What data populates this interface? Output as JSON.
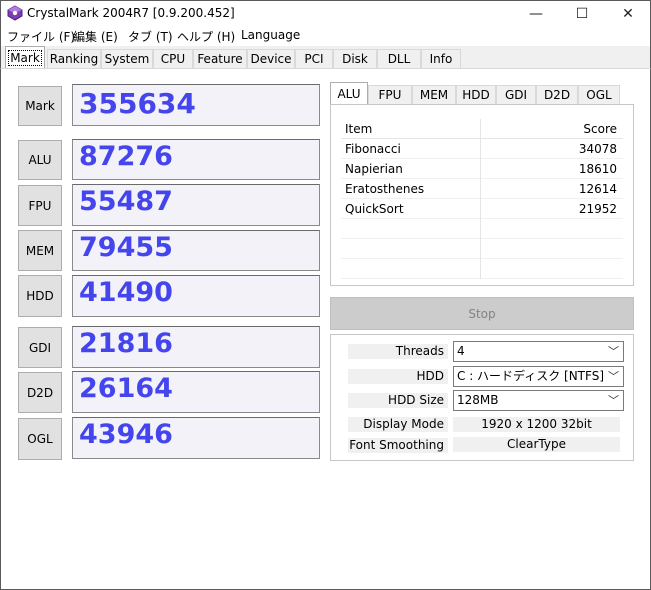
{
  "window": {
    "title": "CrystalMark 2004R7 [0.9.200.452]",
    "controls": {
      "minimize": "—",
      "maximize": "☐",
      "close": "✕"
    }
  },
  "menu": [
    "ファイル (F)",
    "編集 (E)",
    "タブ (T)",
    "ヘルプ (H)",
    "Language"
  ],
  "main_tabs": [
    "Mark",
    "Ranking",
    "System",
    "CPU",
    "Feature",
    "Device",
    "PCI",
    "Disk",
    "DLL",
    "Info"
  ],
  "active_main_tab": "Mark",
  "scores": [
    {
      "label": "Mark",
      "value": "355634"
    },
    {
      "label": "ALU",
      "value": "87276"
    },
    {
      "label": "FPU",
      "value": "55487"
    },
    {
      "label": "MEM",
      "value": "79455"
    },
    {
      "label": "HDD",
      "value": "41490"
    },
    {
      "label": "GDI",
      "value": "21816"
    },
    {
      "label": "D2D",
      "value": "26164"
    },
    {
      "label": "OGL",
      "value": "43946"
    }
  ],
  "sub_tabs": [
    "ALU",
    "FPU",
    "MEM",
    "HDD",
    "GDI",
    "D2D",
    "OGL"
  ],
  "active_sub_tab": "ALU",
  "result_table": {
    "headers": {
      "item": "Item",
      "score": "Score"
    },
    "rows": [
      {
        "item": "Fibonacci",
        "score": "34078"
      },
      {
        "item": "Napierian",
        "score": "18610"
      },
      {
        "item": "Eratosthenes",
        "score": "12614"
      },
      {
        "item": "QuickSort",
        "score": "21952"
      }
    ]
  },
  "stop_button": "Stop",
  "settings": {
    "threads": {
      "label": "Threads",
      "value": "4"
    },
    "hdd": {
      "label": "HDD",
      "value": "C : ハードディスク [NTFS]"
    },
    "hdd_size": {
      "label": "HDD Size",
      "value": "128MB"
    },
    "display_mode": {
      "label": "Display Mode",
      "value": "1920 x 1200 32bit"
    },
    "font_smoothing": {
      "label": "Font Smoothing",
      "value": "ClearType"
    }
  },
  "colors": {
    "score_text": "#4545ee",
    "stop_disabled": "#cccccc"
  }
}
